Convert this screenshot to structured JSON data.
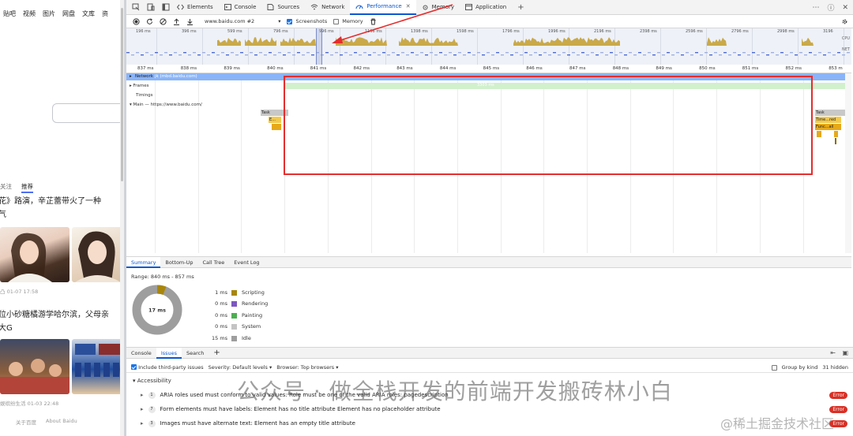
{
  "left_page": {
    "nav": [
      "贴吧",
      "视频",
      "图片",
      "网盘",
      "文库",
      "资"
    ],
    "tabs": [
      "关注",
      "推荐"
    ],
    "news": [
      {
        "title": "花》路演，辛芷蕾带火了一种",
        "title2": "气",
        "meta": "凸   01-07 17:58"
      },
      {
        "title": "位小砂糖橘游学哈尔滨，父母亲",
        "title2": "大G",
        "meta": "娱缤纷生活   01-03 22:48"
      }
    ],
    "footer": [
      "关于百度",
      "About Baidu"
    ]
  },
  "devtools": {
    "tabs": [
      {
        "label": "Elements",
        "icon": "elements-icon"
      },
      {
        "label": "Console",
        "icon": "console-icon"
      },
      {
        "label": "Sources",
        "icon": "sources-icon"
      },
      {
        "label": "Network",
        "icon": "network-icon"
      },
      {
        "label": "Performance",
        "icon": "performance-icon"
      },
      {
        "label": "Memory",
        "icon": "memory-icon"
      },
      {
        "label": "Application",
        "icon": "application-icon"
      }
    ],
    "active_tab": "Performance",
    "toolbar": {
      "target": "www.baidu.com #2",
      "screenshots_label": "Screenshots",
      "screenshots_checked": true,
      "memory_label": "Memory",
      "memory_checked": false
    },
    "overview": {
      "ticks": [
        "196 ms",
        "396 ms",
        "599 ms",
        "796 ms",
        "996 ms",
        "1196 ms",
        "1398 ms",
        "1598 ms",
        "1796 ms",
        "1996 ms",
        "2196 ms",
        "2398 ms",
        "2596 ms",
        "2796 ms",
        "2998 ms",
        "3196"
      ],
      "cpu_label": "CPU",
      "net_label": "NET"
    },
    "ruler": [
      "837 ms",
      "838 ms",
      "839 ms",
      "840 ms",
      "841 ms",
      "842 ms",
      "843 ms",
      "844 ms",
      "845 ms",
      "846 ms",
      "847 ms",
      "848 ms",
      "849 ms",
      "850 ms",
      "851 ms",
      "852 ms",
      "853 m"
    ],
    "tracks": {
      "network_label": "Network",
      "network_req": "jk (mbd.baidu.com)",
      "frames_label": "Frames",
      "frame_value": "3303 ms",
      "timings_label": "Timings",
      "main_label": "Main — https://www.baidu.com/",
      "task_left": "Task",
      "task_right": "Task",
      "timer_right": "Time...red",
      "func_right": "Func...all",
      "small_left": "E..."
    },
    "summary_tabs": [
      "Summary",
      "Bottom-Up",
      "Call Tree",
      "Event Log"
    ],
    "summary": {
      "range": "Range: 840 ms - 857 ms",
      "total": "17 ms",
      "rows": [
        {
          "value": "1 ms",
          "label": "Scripting",
          "color": "#a8860c"
        },
        {
          "value": "0 ms",
          "label": "Rendering",
          "color": "#7e57c2"
        },
        {
          "value": "0 ms",
          "label": "Painting",
          "color": "#4caf50"
        },
        {
          "value": "0 ms",
          "label": "System",
          "color": "#c4c4c4"
        },
        {
          "value": "15 ms",
          "label": "Idle",
          "color": "#9e9e9e"
        }
      ]
    },
    "drawer_tabs": [
      "Console",
      "Issues",
      "Search"
    ],
    "issues_bar": {
      "third_party": "Include third-party issues",
      "severity": "Severity: Default levels",
      "browser": "Browser: Top browsers",
      "group": "Group by kind",
      "hidden": "31 hidden"
    },
    "accordion": "Accessibility",
    "issues": [
      {
        "count": "1",
        "text": "ARIA roles used must conform to valid values: Role must be one of the valid ARIA roles: pagedescription",
        "badge": "Error"
      },
      {
        "count": "7",
        "text": "Form elements must have labels: Element has no title attribute Element has no placeholder attribute",
        "badge": "Error"
      },
      {
        "count": "3",
        "text": "Images must have alternate text: Element has an empty title attribute",
        "badge": "Error"
      }
    ]
  },
  "watermark": {
    "text": "公众号 · 做全栈开发的前端开发搬砖林小白",
    "text2": "@稀土掘金技术社区"
  }
}
